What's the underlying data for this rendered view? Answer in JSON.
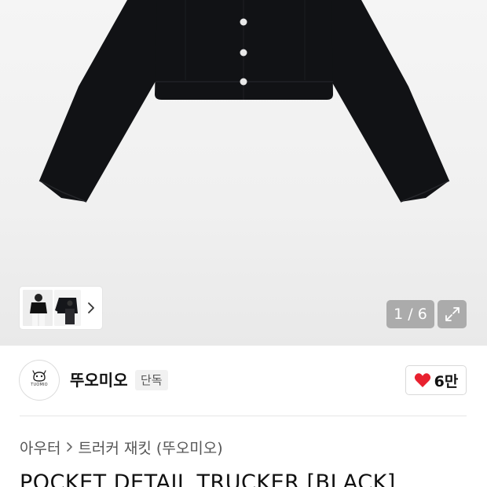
{
  "image": {
    "counter": "1 / 6",
    "thumbnails": [
      "thumb-model-photo",
      "thumb-product-photo"
    ]
  },
  "brand": {
    "name": "뚜오미오",
    "logo_text": "TUOMIO",
    "badge": "단독"
  },
  "like": {
    "count": "6만",
    "color": "#e8212f"
  },
  "breadcrumb": {
    "items": [
      "아우터",
      "트러커 재킷 (뚜오미오)"
    ]
  },
  "product": {
    "title": "POCKET DETAIL TRUCKER [BLACK]"
  },
  "colors": {
    "jacket": "#111215",
    "button": "#e8e8e8"
  }
}
